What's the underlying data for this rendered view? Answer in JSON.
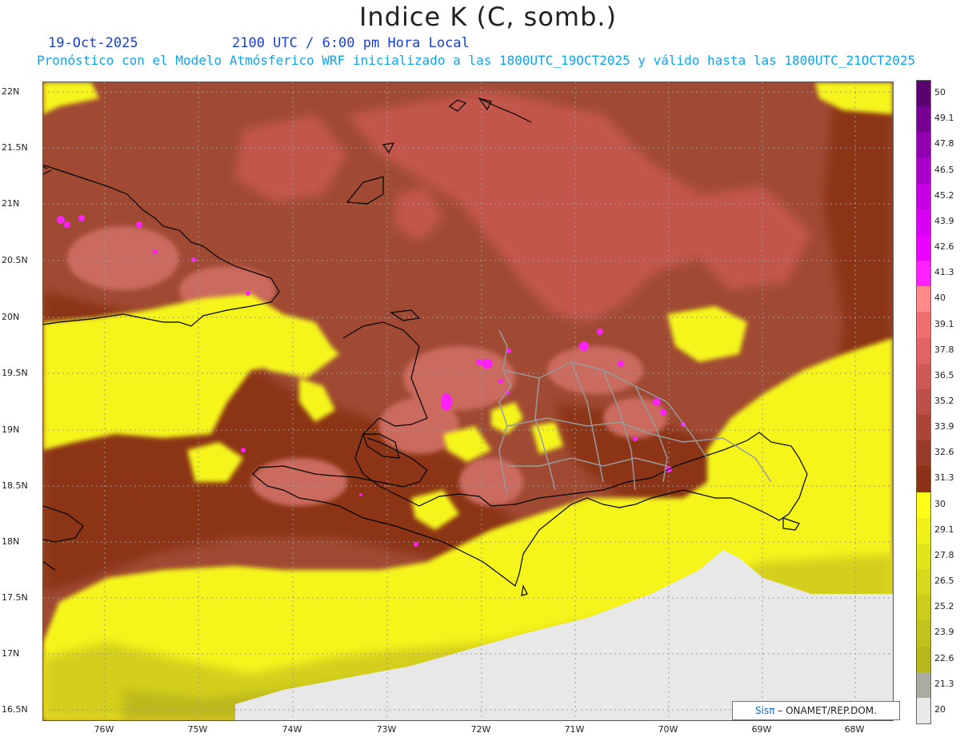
{
  "header": {
    "title": "Indice K (C, somb.)",
    "date": "19-Oct-2025",
    "time": "2100 UTC / 6:00 pm Hora Local",
    "model_line": "Pronóstico con el Modelo Atmósferico WRF inicializado a las 1800UTC_19OCT2025 y válido hasta las  1800UTC_21OCT2025"
  },
  "map": {
    "lat_labels": [
      "22N",
      "21.5N",
      "21N",
      "20.5N",
      "20N",
      "19.5N",
      "19N",
      "18.5N",
      "18N",
      "17.5N",
      "17N",
      "16.5N"
    ],
    "lon_labels": [
      "76W",
      "75W",
      "74W",
      "73W",
      "72W",
      "71W",
      "70W",
      "69W",
      "68W"
    ],
    "lat_range": [
      16.4,
      22.1
    ],
    "lon_range": [
      -76.65,
      -67.65
    ],
    "grid": "dotted",
    "colors": {
      "background_main": "#a04a34",
      "dark_red": "#8c3519",
      "light_red": "#c95f55",
      "pink": "#ff7b7b",
      "magenta": "#ff22ff",
      "yellow": "#f5f51a",
      "olive": "#c2bc1e",
      "no_data": "#e8e8e8",
      "coastline": "#000000",
      "province_borders": "#9a9a9a"
    }
  },
  "colorbar": {
    "labels": [
      "50",
      "49.1",
      "47.8",
      "46.5",
      "45.2",
      "43.9",
      "42.6",
      "41.3",
      "40",
      "39.1",
      "37.8",
      "36.5",
      "35.2",
      "33.9",
      "32.6",
      "31.3",
      "30",
      "29.1",
      "27.8",
      "26.5",
      "25.2",
      "23.9",
      "22.6",
      "21.3",
      "20"
    ],
    "colors": [
      "#5a0070",
      "#760094",
      "#9000b0",
      "#aa00cc",
      "#c400e0",
      "#d800f0",
      "#ea00ff",
      "#ff22ff",
      "#ff8a8a",
      "#f07070",
      "#e06464",
      "#cf5a55",
      "#bd4f47",
      "#aa4538",
      "#983b28",
      "#8a3318",
      "#ffff1a",
      "#f0f01a",
      "#e4e41c",
      "#d8d81e",
      "#cccc1f",
      "#c2c21f",
      "#b8b81e",
      "#ababa0",
      "#e8e8e8"
    ]
  },
  "credit": {
    "sis": "Sisπ",
    "text": "– ONAMET/REP.DOM."
  }
}
